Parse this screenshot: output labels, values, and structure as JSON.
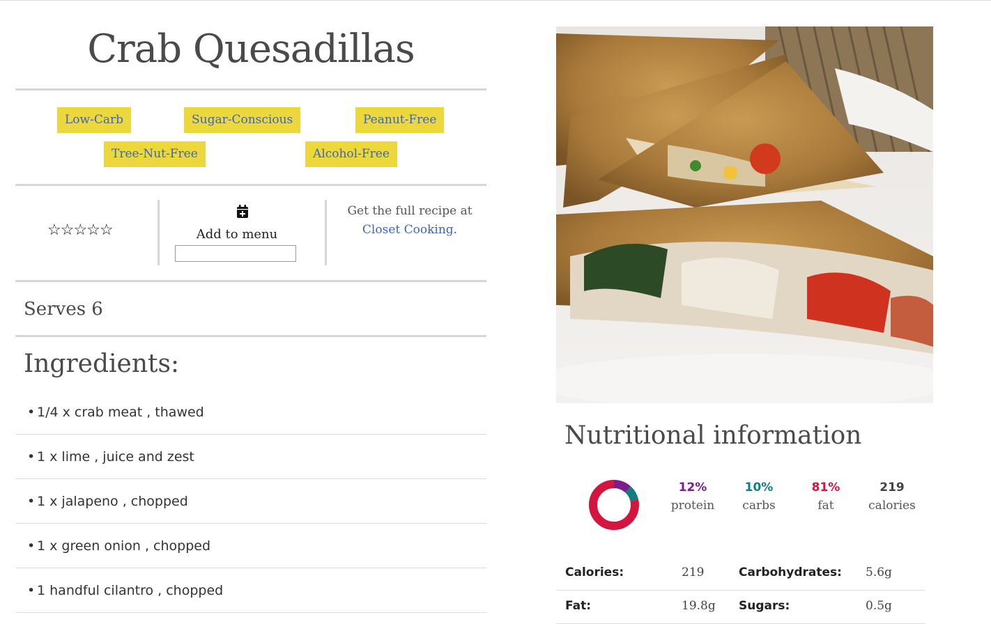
{
  "recipe": {
    "title": "Crab Quesadillas",
    "tags": [
      "Low-Carb",
      "Sugar-Conscious",
      "Peanut-Free",
      "Tree-Nut-Free",
      "Alcohol-Free"
    ],
    "rating_stars": "☆☆☆☆☆",
    "add_to_menu_label": "Add to menu",
    "add_to_menu_value": "",
    "get_full_prefix": "Get the full recipe at",
    "source_name": "Closet Cooking",
    "serves": "Serves 6",
    "ingredients_heading": "Ingredients:",
    "ingredients": [
      "1/4 x crab meat , thawed",
      "1 x lime , juice and zest",
      "1 x jalapeno , chopped",
      "1 x green onion , chopped",
      "1 handful cilantro , chopped"
    ]
  },
  "nutrition": {
    "heading": "Nutritional information",
    "stats": [
      {
        "value": "12%",
        "label": "protein",
        "color": "#7b1e8c",
        "fraction": 0.12
      },
      {
        "value": "10%",
        "label": "carbs",
        "color": "#137d80",
        "fraction": 0.1
      },
      {
        "value": "81%",
        "label": "fat",
        "color": "#d3153f",
        "fraction": 0.81
      },
      {
        "value": "219",
        "label": "calories",
        "color": "#444444"
      }
    ],
    "table": [
      {
        "k1": "Calories:",
        "v1": "219",
        "k2": "Carbohydrates:",
        "v2": "5.6g"
      },
      {
        "k1": "Fat:",
        "v1": "19.8g",
        "k2": "Sugars:",
        "v2": "0.5g"
      }
    ]
  },
  "colors": {
    "tag_background": "#ecd83c",
    "link": "#3e66b4",
    "divider": "#d6d6d6"
  },
  "icons": {
    "calendar": "calendar-plus-icon",
    "stars": "star-outline-icon"
  }
}
